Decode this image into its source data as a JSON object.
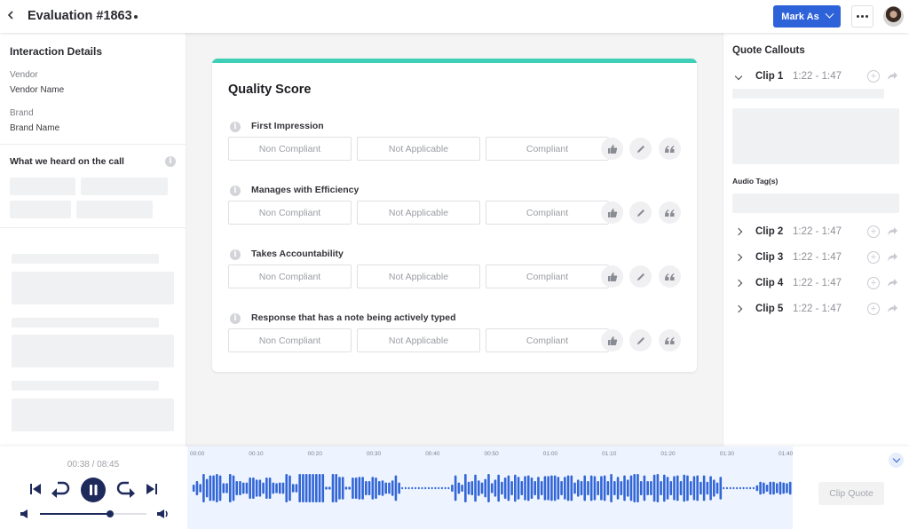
{
  "header": {
    "title": "Evaluation #1863",
    "mark_as_label": "Mark As",
    "accent_color": "#2e62d9"
  },
  "left_panel": {
    "interaction_title": "Interaction Details",
    "fields": [
      {
        "label": "Vendor",
        "value": "Vendor Name"
      },
      {
        "label": "Brand",
        "value": "Brand Name"
      }
    ],
    "heard_title": "What we heard on the call"
  },
  "quality": {
    "title": "Quality Score",
    "accent_color": "#3ecfb6",
    "questions": [
      {
        "label": "First Impression"
      },
      {
        "label": "Manages with Efficiency"
      },
      {
        "label": "Takes Accountability"
      },
      {
        "label": "Response that has a note being actively typed"
      }
    ],
    "options": [
      "Non Compliant",
      "Not Applicable",
      "Compliant"
    ]
  },
  "quote_callouts": {
    "title": "Quote Callouts",
    "audio_tags_label": "Audio Tag(s)",
    "clips": [
      {
        "name": "Clip 1",
        "range": "1:22 - 1:47",
        "expanded": true
      },
      {
        "name": "Clip 2",
        "range": "1:22 - 1:47",
        "expanded": false
      },
      {
        "name": "Clip 3",
        "range": "1:22 - 1:47",
        "expanded": false
      },
      {
        "name": "Clip 4",
        "range": "1:22 - 1:47",
        "expanded": false
      },
      {
        "name": "Clip 5",
        "range": "1:22 - 1:47",
        "expanded": false
      }
    ]
  },
  "player": {
    "time_readout": "00:38 / 08:45",
    "volume_fraction": 0.66,
    "clip_quote_label": "Clip Quote",
    "wave_color": "#3266d6",
    "timeline_ticks": [
      "00:00",
      "00:10",
      "00:20",
      "00:30",
      "00:40",
      "00:50",
      "01:00",
      "01:10",
      "01:20",
      "01:30",
      "01:40"
    ],
    "waveform_amplitudes": [
      0.25,
      0.5,
      0.3,
      1.0,
      0.65,
      0.9,
      0.9,
      1.0,
      0.9,
      0.35,
      0.35,
      1.0,
      0.9,
      0.5,
      0.5,
      0.4,
      0.4,
      0.75,
      0.75,
      0.6,
      0.6,
      0.4,
      0.75,
      0.75,
      0.4,
      0.35,
      0.4,
      0.4,
      1.0,
      0.9,
      0.3,
      0.3,
      1.0,
      1.0,
      1.0,
      1.0,
      1.0,
      1.0,
      1.0,
      1.0,
      0.1,
      0.1,
      1.0,
      1.0,
      0.8,
      0.8,
      0.1,
      0.1,
      0.75,
      0.75,
      0.8,
      0.8,
      0.5,
      0.5,
      0.8,
      0.75,
      0.5,
      0.55,
      0.4,
      0.4,
      0.55,
      0.9,
      0.4,
      0.05,
      0.05,
      0.05,
      0.05,
      0.05,
      0.05,
      0.05,
      0.05,
      0.05,
      0.05,
      0.05,
      0.05,
      0.05,
      0.05,
      0.05,
      0.25,
      0.9,
      0.4,
      0.25,
      1.0,
      0.45,
      0.5,
      0.95,
      0.55,
      0.4,
      0.65,
      1.0,
      0.35,
      0.6,
      0.95,
      0.45,
      0.75,
      0.9,
      0.5,
      0.95,
      0.8,
      0.5,
      0.85,
      0.9,
      0.75,
      0.5,
      0.8,
      0.5,
      0.85,
      0.85,
      0.9,
      0.9,
      0.8,
      0.5,
      0.8,
      0.9,
      0.9,
      0.4,
      0.6,
      0.5,
      0.9,
      0.5,
      0.9,
      0.85,
      0.5,
      0.85,
      0.9,
      0.5,
      1.0,
      0.5,
      0.8,
      0.5,
      0.9,
      0.6,
      0.9,
      1.0,
      1.0,
      0.5,
      0.9,
      0.5,
      0.5,
      0.95,
      1.0,
      0.5,
      0.95,
      0.8,
      0.5,
      0.85,
      0.9,
      0.5,
      0.95,
      0.9,
      0.5,
      0.85,
      0.9,
      0.45,
      0.9,
      0.45,
      0.85,
      0.6,
      0.4,
      0.8,
      0.05,
      0.05,
      0.05,
      0.05,
      0.05,
      0.05,
      0.05,
      0.05,
      0.05,
      0.05,
      0.2,
      0.45,
      0.4,
      0.25,
      0.45,
      0.45,
      0.35,
      0.45,
      0.4,
      0.35,
      0.45
    ]
  }
}
